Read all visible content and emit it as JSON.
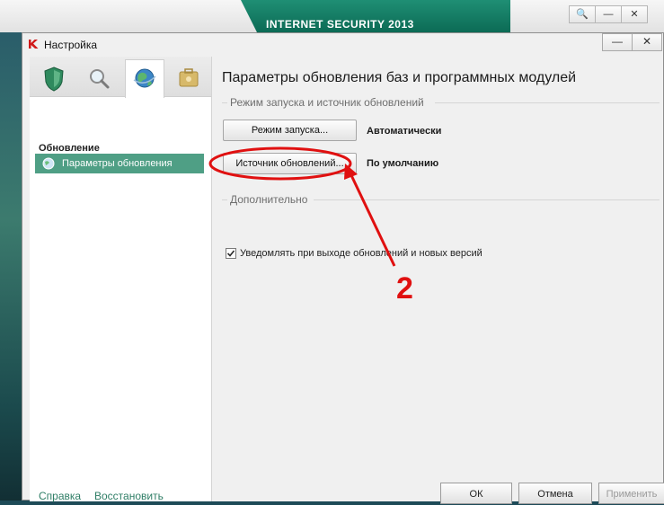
{
  "background_app": {
    "banner_text": "INTERNET SECURITY 2013",
    "controls": [
      "🔍",
      "—",
      "✕"
    ]
  },
  "window": {
    "title": "Настройка",
    "controls": [
      "—",
      "✕"
    ]
  },
  "sidebar": {
    "tabs": [
      {
        "icon": "shield-icon",
        "active": false
      },
      {
        "icon": "magnifier-icon",
        "active": false
      },
      {
        "icon": "globe-icon",
        "active": true
      },
      {
        "icon": "toolbox-icon",
        "active": false
      }
    ],
    "section_title": "Обновление",
    "items": [
      {
        "label": "Параметры обновления",
        "selected": true
      }
    ]
  },
  "main": {
    "title": "Параметры обновления баз и программных модулей",
    "group1": {
      "label": "Режим запуска и источник обновлений",
      "run_mode_button": "Режим запуска...",
      "run_mode_value": "Автоматически",
      "source_button": "Источник обновлений...",
      "source_value": "По умолчанию"
    },
    "group2": {
      "label": "Дополнительно",
      "notify_checkbox": {
        "label": "Уведомлять при выходе обновлений и новых версий",
        "checked": true
      }
    }
  },
  "footer": {
    "help_link": "Справка",
    "restore_link": "Восстановить",
    "ok_button": "ОК",
    "cancel_button": "Отмена",
    "apply_button": "Применить"
  },
  "annotation": {
    "number": "2",
    "color": "#e01010"
  },
  "colors": {
    "accent": "#4f9f85",
    "link": "#2f7e66",
    "banner": "#0c6b55"
  }
}
